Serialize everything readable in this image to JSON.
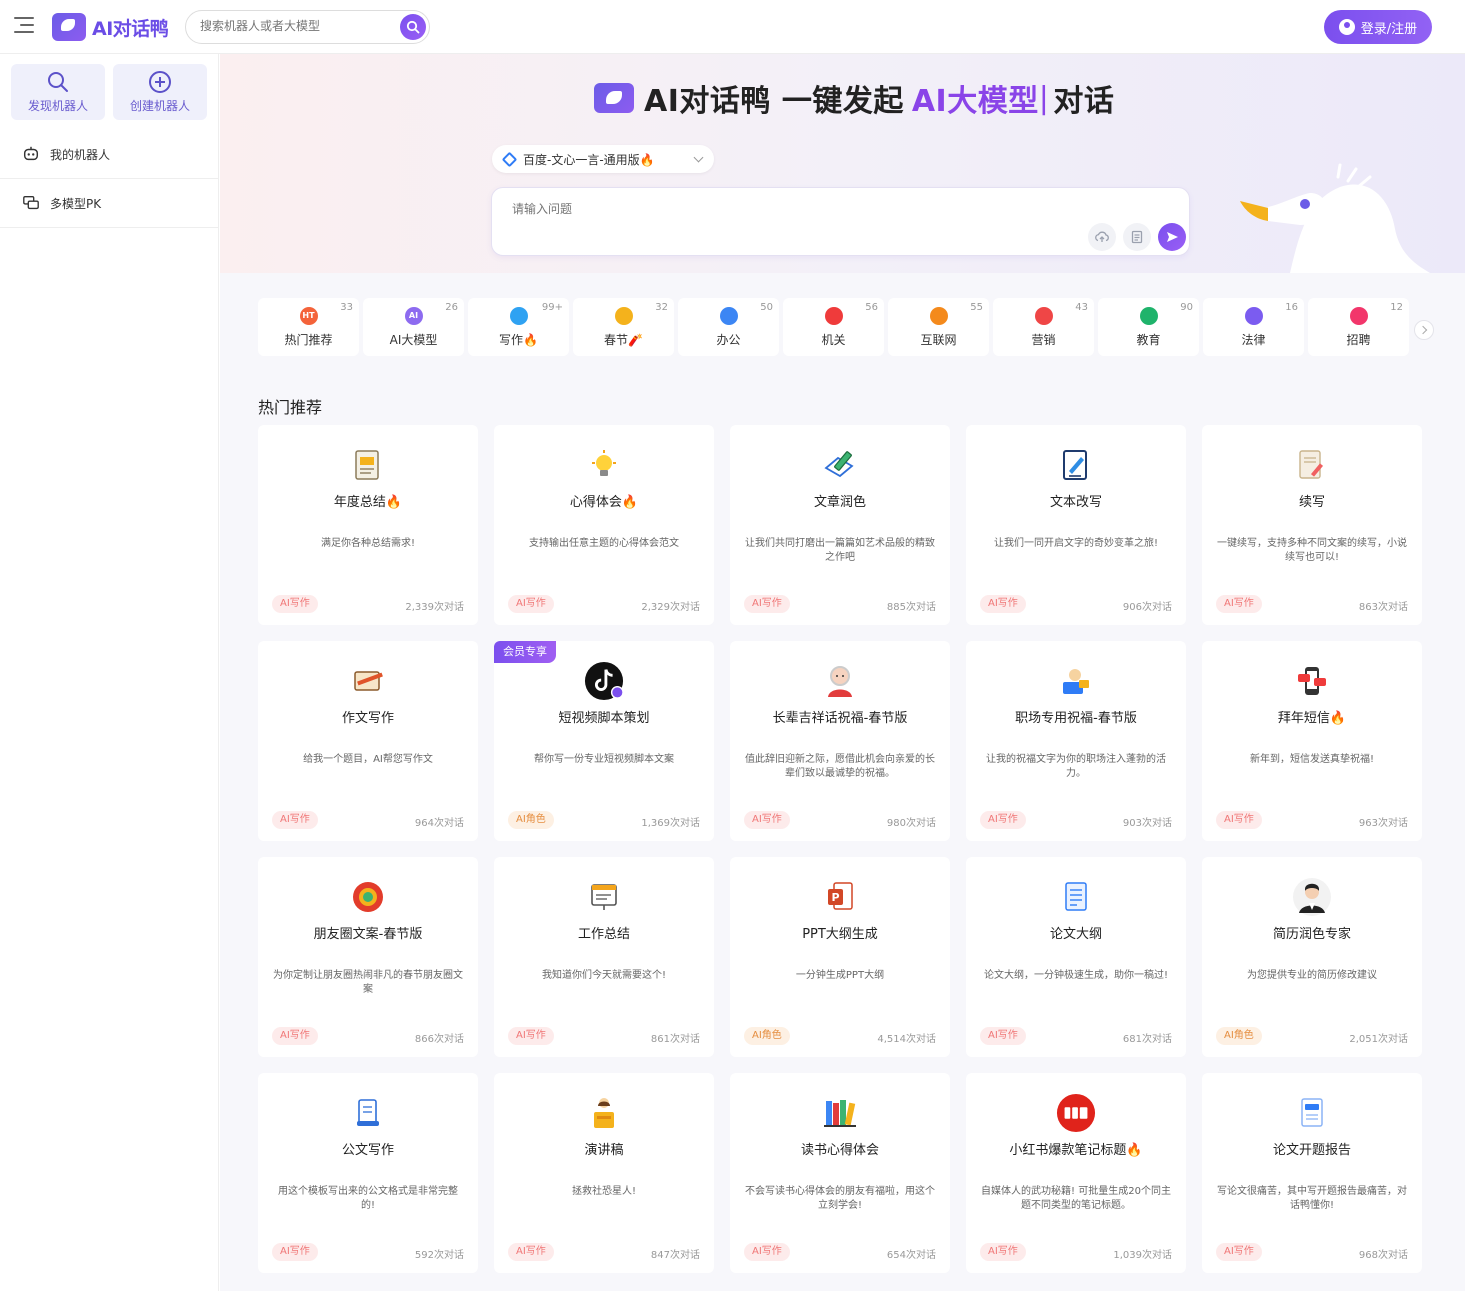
{
  "header": {
    "logo_text": "AI对话鸭",
    "search_placeholder": "搜索机器人或者大模型",
    "login_label": "登录/注册"
  },
  "sidebar": {
    "cards": [
      {
        "label": "发现机器人",
        "icon": "search-icon"
      },
      {
        "label": "创建机器人",
        "icon": "plus-circle-icon"
      }
    ],
    "items": [
      {
        "label": "我的机器人",
        "icon": "robot-icon"
      },
      {
        "label": "多模型PK",
        "icon": "chat-compare-icon"
      }
    ]
  },
  "hero": {
    "title_main": "AI对话鸭 一键发起 ",
    "title_accent": "AI大模型",
    "title_cursor": "|",
    "title_tail": " 对话",
    "model_selected": "百度-文心一言-通用版🔥",
    "ask_placeholder": "请输入问题"
  },
  "categories": [
    {
      "label": "热门推荐",
      "count": "33",
      "color": "#f4633a",
      "badge": "HT"
    },
    {
      "label": "AI大模型",
      "count": "26",
      "color": "#8d6bf0",
      "badge": "AI"
    },
    {
      "label": "写作🔥",
      "count": "99+",
      "color": "#2fa2f2",
      "badge": ""
    },
    {
      "label": "春节🧨",
      "count": "32",
      "color": "#f4b21c",
      "badge": ""
    },
    {
      "label": "办公",
      "count": "50",
      "color": "#3c86f4",
      "badge": ""
    },
    {
      "label": "机关",
      "count": "56",
      "color": "#ef3b3b",
      "badge": ""
    },
    {
      "label": "互联网",
      "count": "55",
      "color": "#f48a1c",
      "badge": ""
    },
    {
      "label": "营销",
      "count": "43",
      "color": "#ef4646",
      "badge": ""
    },
    {
      "label": "教育",
      "count": "90",
      "color": "#1fb36b",
      "badge": ""
    },
    {
      "label": "法律",
      "count": "16",
      "color": "#7b5cf0",
      "badge": ""
    },
    {
      "label": "招聘",
      "count": "12",
      "color": "#f2366b",
      "badge": ""
    }
  ],
  "section_title": "热门推荐",
  "bots": [
    {
      "title": "年度总结🔥",
      "desc": "满足你各种总结需求!",
      "tag": "AI写作",
      "tag_type": "write",
      "uses": "2,339次对话",
      "icon": "report-icon",
      "vip": ""
    },
    {
      "title": "心得体会🔥",
      "desc": "支持输出任意主题的心得体会范文",
      "tag": "AI写作",
      "tag_type": "write",
      "uses": "2,329次对话",
      "icon": "lightbulb-icon",
      "vip": ""
    },
    {
      "title": "文章润色",
      "desc": "让我们共同打磨出一篇篇如艺术品般的精致之作吧",
      "tag": "AI写作",
      "tag_type": "write",
      "uses": "885次对话",
      "icon": "pencil-paper-icon",
      "vip": ""
    },
    {
      "title": "文本改写",
      "desc": "让我们一同开启文字的奇妙变革之旅!",
      "tag": "AI写作",
      "tag_type": "write",
      "uses": "906次对话",
      "icon": "edit-doc-icon",
      "vip": ""
    },
    {
      "title": "续写",
      "desc": "一键续写，支持多种不同文案的续写，小说续写也可以!",
      "tag": "AI写作",
      "tag_type": "write",
      "uses": "863次对话",
      "icon": "doc-pen-icon",
      "vip": ""
    },
    {
      "title": "作文写作",
      "desc": "给我一个题目，AI帮您写作文",
      "tag": "AI写作",
      "tag_type": "write",
      "uses": "964次对话",
      "icon": "notebook-pen-icon",
      "vip": ""
    },
    {
      "title": "短视频脚本策划",
      "desc": "帮你写一份专业短视频脚本文案",
      "tag": "AI角色",
      "tag_type": "role",
      "uses": "1,369次对话",
      "icon": "tiktok-icon",
      "vip": "会员专享"
    },
    {
      "title": "长辈吉祥话祝福-春节版",
      "desc": "值此辞旧迎新之际，愿借此机会向亲爱的长辈们致以最诚挚的祝福。",
      "tag": "AI写作",
      "tag_type": "write",
      "uses": "980次对话",
      "icon": "elder-avatar-icon",
      "vip": ""
    },
    {
      "title": "职场专用祝福-春节版",
      "desc": "让我的祝福文字为你的职场注入蓬勃的活力。",
      "tag": "AI写作",
      "tag_type": "write",
      "uses": "903次对话",
      "icon": "office-worker-icon",
      "vip": ""
    },
    {
      "title": "拜年短信🔥",
      "desc": "新年到，短信发送真挚祝福!",
      "tag": "AI写作",
      "tag_type": "write",
      "uses": "963次对话",
      "icon": "phone-message-icon",
      "vip": ""
    },
    {
      "title": "朋友圈文案-春节版",
      "desc": "为你定制让朋友圈热闹非凡的春节朋友圈文案",
      "tag": "AI写作",
      "tag_type": "write",
      "uses": "866次对话",
      "icon": "moments-icon",
      "vip": ""
    },
    {
      "title": "工作总结",
      "desc": "我知道你们今天就需要这个!",
      "tag": "AI写作",
      "tag_type": "write",
      "uses": "861次对话",
      "icon": "board-report-icon",
      "vip": ""
    },
    {
      "title": "PPT大纲生成",
      "desc": "一分钟生成PPT大纲",
      "tag": "AI角色",
      "tag_type": "role",
      "uses": "4,514次对话",
      "icon": "ppt-icon",
      "vip": ""
    },
    {
      "title": "论文大纲",
      "desc": "论文大纲，一分钟极速生成，助你一稿过!",
      "tag": "AI写作",
      "tag_type": "write",
      "uses": "681次对话",
      "icon": "document-list-icon",
      "vip": ""
    },
    {
      "title": "简历润色专家",
      "desc": "为您提供专业的简历修改建议",
      "tag": "AI角色",
      "tag_type": "role",
      "uses": "2,051次对话",
      "icon": "professional-avatar-icon",
      "vip": ""
    },
    {
      "title": "公文写作",
      "desc": "用这个模板写出来的公文格式是非常完整的!",
      "tag": "AI写作",
      "tag_type": "write",
      "uses": "592次对话",
      "icon": "scroll-doc-icon",
      "vip": ""
    },
    {
      "title": "演讲稿",
      "desc": "拯救社恐星人!",
      "tag": "AI写作",
      "tag_type": "write",
      "uses": "847次对话",
      "icon": "podium-speaker-icon",
      "vip": ""
    },
    {
      "title": "读书心得体会",
      "desc": "不会写读书心得体会的朋友有福啦，用这个立刻学会!",
      "tag": "AI写作",
      "tag_type": "write",
      "uses": "654次对话",
      "icon": "bookshelf-icon",
      "vip": ""
    },
    {
      "title": "小红书爆款笔记标题🔥",
      "desc": "自媒体人的武功秘籍! 可批量生成20个同主题不同类型的笔记标题。",
      "tag": "AI写作",
      "tag_type": "write",
      "uses": "1,039次对话",
      "icon": "xiaohongshu-icon",
      "vip": ""
    },
    {
      "title": "论文开题报告",
      "desc": "写论文很痛苦，其中写开题报告最痛苦，对话鸭懂你!",
      "tag": "AI写作",
      "tag_type": "write",
      "uses": "968次对话",
      "icon": "title-doc-icon",
      "vip": ""
    }
  ]
}
